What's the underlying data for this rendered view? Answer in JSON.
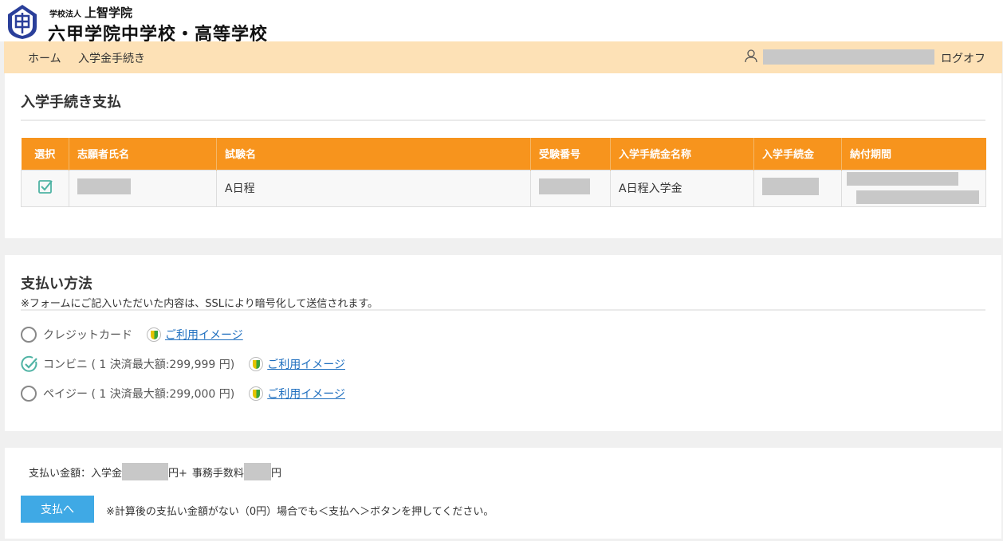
{
  "header": {
    "corp_prefix": "学校法人",
    "corp_name": "上智学院",
    "school_name": "六甲学院中学校・高等学校"
  },
  "nav": {
    "home": "ホーム",
    "procedure": "入学金手続き",
    "logout": "ログオフ"
  },
  "payment_section": {
    "title": "入学手続き支払",
    "columns": [
      "選択",
      "志願者氏名",
      "試験名",
      "受験番号",
      "入学手続金名称",
      "入学手続金",
      "納付期間"
    ],
    "row": {
      "exam_name": "A日程",
      "fee_name": "A日程入学金"
    }
  },
  "method_section": {
    "title": "支払い方法",
    "note": "※フォームにご記入いただいた内容は、SSLにより暗号化して送信されます。",
    "options": [
      {
        "label": "クレジットカード",
        "selected": false,
        "link": "ご利用イメージ"
      },
      {
        "label": "コンビニ ( 1 決済最大額:299,999 円)",
        "selected": true,
        "link": "ご利用イメージ"
      },
      {
        "label": "ペイジー ( 1 決済最大額:299,000 円)",
        "selected": false,
        "link": "ご利用イメージ"
      }
    ]
  },
  "summary": {
    "amount_prefix": "支払い金額：入学金",
    "yen1": "円+",
    "fee_label": "事務手数料",
    "yen2": "円",
    "button": "支払へ",
    "button_note": "※計算後の支払い金額がない（0円）場合でも＜支払へ＞ボタンを押してください。"
  },
  "colors": {
    "accent_orange": "#f7941d",
    "nav_bg": "#fde1b6",
    "button_blue": "#3fa9e5",
    "check_teal": "#4fb3a4",
    "redacted_grey": "#c8c8c8"
  }
}
